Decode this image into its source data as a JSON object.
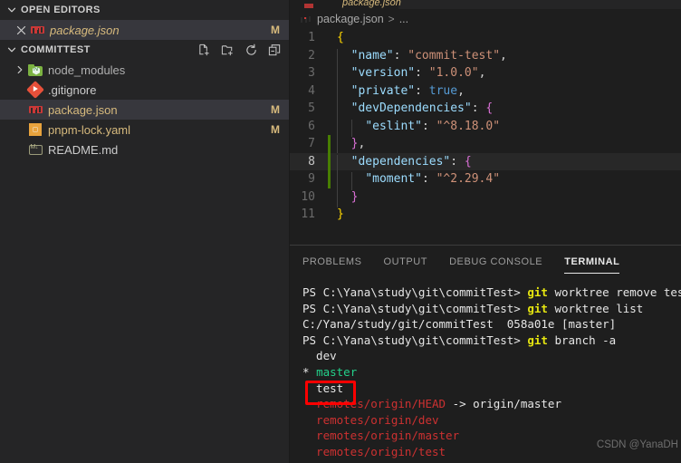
{
  "sidebar": {
    "open_editors": {
      "header": "OPEN EDITORS",
      "twisty_icon": "chevron-down-icon",
      "items": [
        {
          "name": "package.json",
          "icon": "npm-icon",
          "badge": "M",
          "close_icon": "close-icon"
        }
      ]
    },
    "explorer": {
      "header": "COMMITTEST",
      "twisty_icon": "chevron-down-icon",
      "actions": [
        {
          "icon": "new-file-icon",
          "title": "New File"
        },
        {
          "icon": "new-folder-icon",
          "title": "New Folder"
        },
        {
          "icon": "refresh-icon",
          "title": "Refresh Explorer"
        },
        {
          "icon": "collapse-all-icon",
          "title": "Collapse Folders in Explorer"
        }
      ],
      "items": [
        {
          "name": "node_modules",
          "icon": "node-folder-icon",
          "chevron": "chevron-right-icon",
          "badge": "",
          "kind": "folder"
        },
        {
          "name": ".gitignore",
          "icon": "git-icon",
          "badge": "",
          "kind": "file"
        },
        {
          "name": "package.json",
          "icon": "npm-icon",
          "badge": "M",
          "kind": "file",
          "selected": true
        },
        {
          "name": "pnpm-lock.yaml",
          "icon": "yaml-icon",
          "badge": "M",
          "kind": "file"
        },
        {
          "name": "README.md",
          "icon": "markdown-icon",
          "badge": "",
          "kind": "file"
        }
      ]
    }
  },
  "editor": {
    "tab": {
      "label": "package.json",
      "icon": "npm-icon"
    },
    "breadcrumb": {
      "file": "package.json",
      "separator": ">",
      "more": "..."
    },
    "lines": [
      {
        "n": "1",
        "text": "{"
      },
      {
        "n": "2",
        "text": "  \"name\": \"commit-test\","
      },
      {
        "n": "3",
        "text": "  \"version\": \"1.0.0\","
      },
      {
        "n": "4",
        "text": "  \"private\": true,"
      },
      {
        "n": "5",
        "text": "  \"devDependencies\": {"
      },
      {
        "n": "6",
        "text": "    \"eslint\": \"^8.18.0\""
      },
      {
        "n": "7",
        "text": "  },"
      },
      {
        "n": "8",
        "text": "  \"dependencies\": {"
      },
      {
        "n": "9",
        "text": "    \"moment\": \"^2.29.4\""
      },
      {
        "n": "10",
        "text": "  }"
      },
      {
        "n": "11",
        "text": "}"
      }
    ],
    "current_line": "8",
    "git_added_lines": [
      "7",
      "8",
      "9"
    ]
  },
  "panel": {
    "tabs": [
      {
        "label": "PROBLEMS",
        "active": false
      },
      {
        "label": "OUTPUT",
        "active": false
      },
      {
        "label": "DEBUG CONSOLE",
        "active": false
      },
      {
        "label": "TERMINAL",
        "active": true
      }
    ],
    "terminal_lines": [
      {
        "prompt": "PS C:\\Yana\\study\\git\\commitTest> ",
        "cmd": "git",
        "args": " worktree remove test"
      },
      {
        "prompt": "PS C:\\Yana\\study\\git\\commitTest> ",
        "cmd": "git",
        "args": " worktree list"
      },
      {
        "plain": "C:/Yana/study/git/commitTest  058a01e [master]"
      },
      {
        "prompt": "PS C:\\Yana\\study\\git\\commitTest> ",
        "cmd": "git",
        "args": " branch -a"
      },
      {
        "branch": "  dev",
        "color": "white"
      },
      {
        "branch": "* master",
        "color": "green",
        "star": "*"
      },
      {
        "branch": "  test",
        "color": "white"
      },
      {
        "branch": "  remotes/origin/HEAD",
        "suffix": " -> origin/master",
        "color": "red"
      },
      {
        "branch": "  remotes/origin/dev",
        "color": "red"
      },
      {
        "branch": "  remotes/origin/master",
        "color": "red"
      },
      {
        "branch": "  remotes/origin/test",
        "color": "red"
      }
    ]
  },
  "annotation": {
    "highlight_label": "test",
    "box_color": "#fe0000"
  },
  "watermark": {
    "text": "CSDN @YanaDH"
  }
}
